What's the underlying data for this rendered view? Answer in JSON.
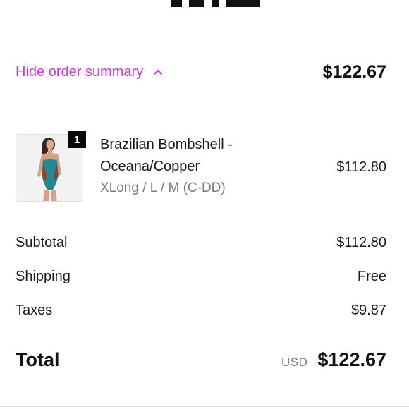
{
  "summary_toggle": {
    "label": "Hide order summary",
    "total": "$122.67",
    "accent_color": "#d633e6",
    "icon": "chevron-up-icon"
  },
  "line_items": [
    {
      "quantity": "1",
      "name_line1": "Brazilian Bombshell -",
      "name_line2": "Oceana/Copper",
      "variant": "XLong / L / M (C-DD)",
      "price": "$112.80",
      "image": "swimsuit-product-image"
    }
  ],
  "costs": {
    "subtotal_label": "Subtotal",
    "subtotal_value": "$112.80",
    "shipping_label": "Shipping",
    "shipping_value": "Free",
    "taxes_label": "Taxes",
    "taxes_value": "$9.87"
  },
  "total": {
    "label": "Total",
    "currency": "USD",
    "amount": "$122.67"
  }
}
